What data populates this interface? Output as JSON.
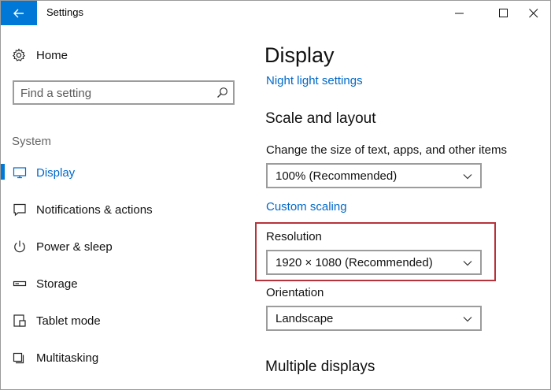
{
  "window": {
    "title": "Settings",
    "controls": [
      "minimize-icon",
      "maximize-icon",
      "close-icon"
    ]
  },
  "sidebar": {
    "home_label": "Home",
    "search": {
      "placeholder": "Find a setting",
      "value": ""
    },
    "section_label": "System",
    "items": [
      {
        "label": "Display",
        "icon": "monitor-icon",
        "active": true
      },
      {
        "label": "Notifications & actions",
        "icon": "notifications-icon",
        "active": false
      },
      {
        "label": "Power & sleep",
        "icon": "power-icon",
        "active": false
      },
      {
        "label": "Storage",
        "icon": "storage-icon",
        "active": false
      },
      {
        "label": "Tablet mode",
        "icon": "tablet-mode-icon",
        "active": false
      },
      {
        "label": "Multitasking",
        "icon": "multitasking-icon",
        "active": false
      }
    ]
  },
  "main": {
    "title": "Display",
    "night_light_link": "Night light settings",
    "scale_heading": "Scale and layout",
    "scale_label": "Change the size of text, apps, and other items",
    "scale_value": "100% (Recommended)",
    "custom_scaling_link": "Custom scaling",
    "resolution_label": "Resolution",
    "resolution_value": "1920 × 1080 (Recommended)",
    "orientation_label": "Orientation",
    "orientation_value": "Landscape",
    "multiple_displays_heading": "Multiple displays"
  },
  "colors": {
    "accent": "#0078d7",
    "link": "#0068c8",
    "highlight": "#b5333b"
  }
}
